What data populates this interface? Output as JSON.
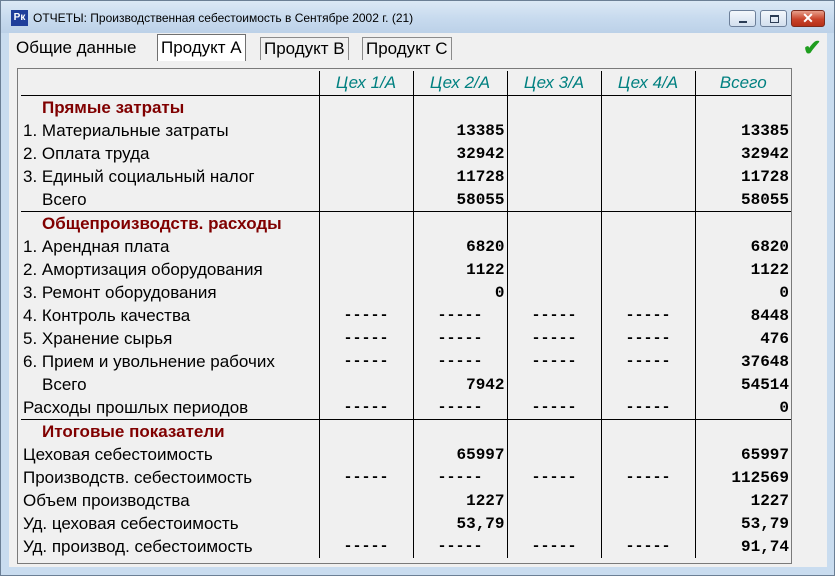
{
  "window": {
    "title": "ОТЧЕТЫ: Производственная себестоимость в Сентябре 2002 г. (21)",
    "icon": "app-icon",
    "controls": {
      "minimize": "minimize",
      "maximize": "maximize",
      "close": "✕"
    }
  },
  "tabs": [
    {
      "label": "Общие данные",
      "active": false
    },
    {
      "label": "Продукт A",
      "active": true
    },
    {
      "label": "Продукт B",
      "active": false
    },
    {
      "label": "Продукт C",
      "active": false
    }
  ],
  "confirm_icon": {
    "glyph": "✔",
    "color": "#1f9e1f"
  },
  "colors": {
    "section": "#800000",
    "header": "#008080"
  },
  "table": {
    "columns": [
      "Цех 1/А",
      "Цех 2/А",
      "Цех 3/А",
      "Цех 4/А",
      "Всего"
    ],
    "rows": [
      {
        "type": "section",
        "label": "Прямые затраты",
        "cells": [
          "",
          "",
          "",
          "",
          ""
        ]
      },
      {
        "type": "data",
        "label": "1. Материальные затраты",
        "cells": [
          "",
          "13385",
          "",
          "",
          "13385"
        ]
      },
      {
        "type": "data",
        "label": "2. Оплата труда",
        "cells": [
          "",
          "32942",
          "",
          "",
          "32942"
        ]
      },
      {
        "type": "data",
        "label": "3. Единый социальный налог",
        "cells": [
          "",
          "11728",
          "",
          "",
          "11728"
        ]
      },
      {
        "type": "total",
        "label": "Всего",
        "cells": [
          "",
          "58055",
          "",
          "",
          "58055"
        ]
      },
      {
        "type": "section",
        "label": "Общепроизводств. расходы",
        "cells": [
          "",
          "",
          "",
          "",
          ""
        ],
        "topBorder": true
      },
      {
        "type": "data",
        "label": "1. Арендная плата",
        "cells": [
          "",
          "6820",
          "",
          "",
          "6820"
        ]
      },
      {
        "type": "data",
        "label": "2. Амортизация оборудования",
        "cells": [
          "",
          "1122",
          "",
          "",
          "1122"
        ]
      },
      {
        "type": "data",
        "label": "3. Ремонт оборудования",
        "cells": [
          "",
          "0",
          "",
          "",
          "0"
        ]
      },
      {
        "type": "data",
        "label": "4. Контроль качества",
        "cells": [
          "-----",
          "-----",
          "-----",
          "-----",
          "8448"
        ]
      },
      {
        "type": "data",
        "label": "5. Хранение сырья",
        "cells": [
          "-----",
          "-----",
          "-----",
          "-----",
          "476"
        ]
      },
      {
        "type": "data",
        "label": "6. Прием и увольнение рабочих",
        "cells": [
          "-----",
          "-----",
          "-----",
          "-----",
          "37648"
        ]
      },
      {
        "type": "total",
        "label": "Всего",
        "cells": [
          "",
          "7942",
          "",
          "",
          "54514"
        ]
      },
      {
        "type": "data",
        "label": "Расходы прошлых периодов",
        "cells": [
          "-----",
          "-----",
          "-----",
          "-----",
          "0"
        ]
      },
      {
        "type": "section",
        "label": "Итоговые показатели",
        "cells": [
          "",
          "",
          "",
          "",
          ""
        ],
        "topBorder": true
      },
      {
        "type": "data",
        "label": "Цеховая себестоимость",
        "cells": [
          "",
          "65997",
          "",
          "",
          "65997"
        ]
      },
      {
        "type": "data",
        "label": "Производств. себестоимость",
        "cells": [
          "-----",
          "-----",
          "-----",
          "-----",
          "112569"
        ]
      },
      {
        "type": "data",
        "label": "Объем производства",
        "cells": [
          "",
          "1227",
          "",
          "",
          "1227"
        ]
      },
      {
        "type": "data",
        "label": "Уд. цеховая себестоимость",
        "cells": [
          "",
          "53,79",
          "",
          "",
          "53,79"
        ]
      },
      {
        "type": "data",
        "label": "Уд. производ. себестоимость",
        "cells": [
          "-----",
          "-----",
          "-----",
          "-----",
          "91,74"
        ]
      }
    ]
  }
}
